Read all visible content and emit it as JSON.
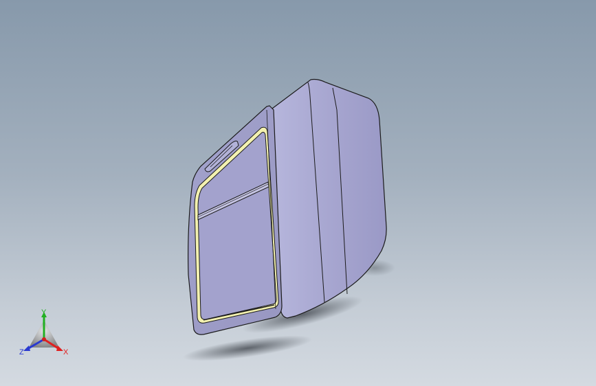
{
  "viewport": {
    "background_top": "#8799ab",
    "background_bottom": "#d4dae1"
  },
  "model": {
    "name": "door-panel",
    "face_color": "#a9a8cf",
    "edge_color": "#1a1a1a",
    "seal_color": "#f2f0a8"
  },
  "triad": {
    "x_label": "X",
    "y_label": "Y",
    "z_label": "Z",
    "x_color": "#e02020",
    "y_color": "#22b022",
    "z_color": "#2a3ad0"
  }
}
